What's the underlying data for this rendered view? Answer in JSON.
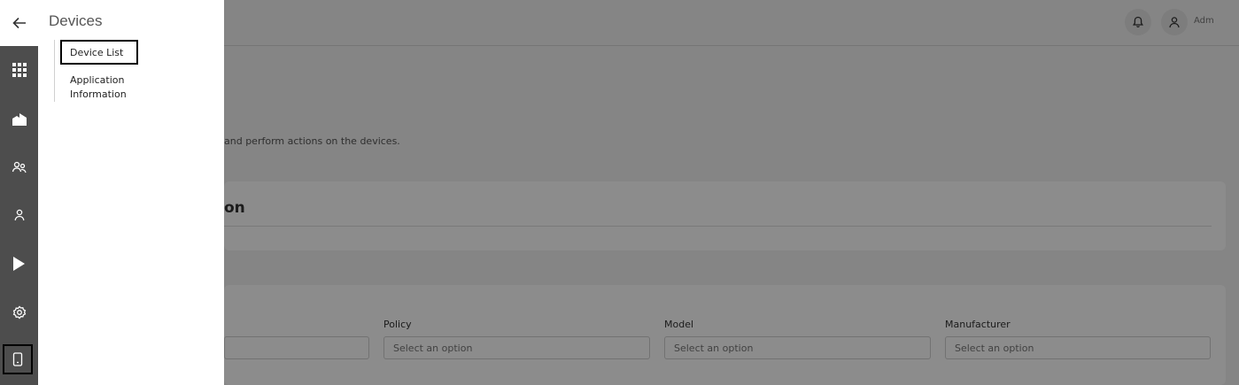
{
  "panel": {
    "title": "Devices",
    "items": [
      {
        "label": "Device List"
      },
      {
        "label": "Application Information"
      }
    ]
  },
  "header": {
    "user_name": "Adm"
  },
  "main": {
    "subtitle": "and perform actions on the devices.",
    "info_card_title": "on",
    "filters": [
      {
        "label": "Policy",
        "placeholder": "Select an option"
      },
      {
        "label": "Model",
        "placeholder": "Select an option"
      },
      {
        "label": "Manufacturer",
        "placeholder": "Select an option"
      }
    ]
  },
  "rail": {
    "icons": [
      "back-arrow-icon",
      "apps-grid-icon",
      "home-icon",
      "users-icon",
      "user-icon",
      "play-icon",
      "settings-icon",
      "device-icon"
    ]
  }
}
